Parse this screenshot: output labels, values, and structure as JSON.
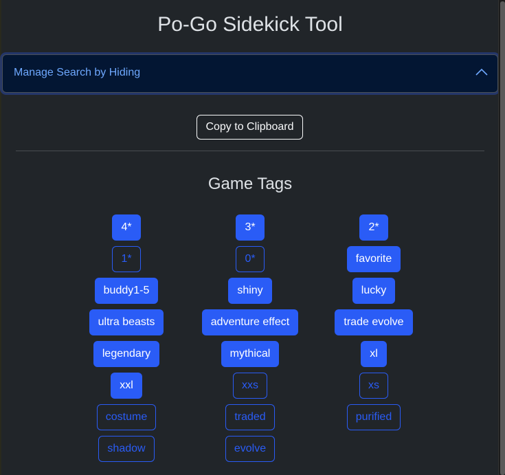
{
  "app": {
    "title": "Po-Go Sidekick Tool"
  },
  "accordion": {
    "label": "Manage Search by Hiding",
    "expanded": true,
    "icon": "chevron-up-icon"
  },
  "toolbar": {
    "copy_label": "Copy to Clipboard"
  },
  "game_tags": {
    "title": "Game Tags",
    "colors": {
      "active_bg": "#2a5cf6",
      "active_text": "#ffffff",
      "inactive_border": "#2a5cf6",
      "inactive_text": "#2a5cf6"
    },
    "columns": [
      [
        {
          "label": "4*",
          "active": true
        },
        {
          "label": "1*",
          "active": false
        },
        {
          "label": "buddy1-5",
          "active": true
        },
        {
          "label": "ultra beasts",
          "active": true
        },
        {
          "label": "legendary",
          "active": true
        },
        {
          "label": "xxl",
          "active": true
        },
        {
          "label": "costume",
          "active": false
        },
        {
          "label": "shadow",
          "active": false
        }
      ],
      [
        {
          "label": "3*",
          "active": true
        },
        {
          "label": "0*",
          "active": false
        },
        {
          "label": "shiny",
          "active": true
        },
        {
          "label": "adventure effect",
          "active": true
        },
        {
          "label": "mythical",
          "active": true
        },
        {
          "label": "xxs",
          "active": false
        },
        {
          "label": "traded",
          "active": false
        },
        {
          "label": "evolve",
          "active": false
        }
      ],
      [
        {
          "label": "2*",
          "active": true
        },
        {
          "label": "favorite",
          "active": true
        },
        {
          "label": "lucky",
          "active": true
        },
        {
          "label": "trade evolve",
          "active": true
        },
        {
          "label": "xl",
          "active": true
        },
        {
          "label": "xs",
          "active": false
        },
        {
          "label": "purified",
          "active": false
        }
      ]
    ]
  }
}
